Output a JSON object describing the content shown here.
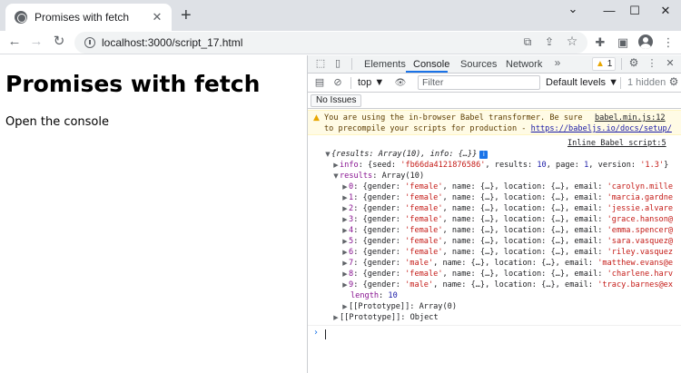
{
  "browser": {
    "tab_title": "Promises with fetch",
    "tab_close": "✕",
    "new_tab": "+",
    "win_minimize": "—",
    "win_maximize": "☐",
    "win_close": "✕",
    "collapse": "⌄",
    "url": "localhost:3000/script_17.html",
    "nav": {
      "back": "←",
      "forward": "→",
      "reload": "↻"
    },
    "omnibox_icons": {
      "translate": "⧉",
      "share": "⇪",
      "bookmark": "☆"
    },
    "toolbar_icons": {
      "extensions": "✚",
      "sidepanel": "▣",
      "menu": "⋮"
    }
  },
  "page": {
    "heading": "Promises with fetch",
    "text": "Open the console"
  },
  "devtools": {
    "icons": {
      "inspect": "⬚",
      "device": "▯",
      "more_tabs": "»",
      "settings": "⚙",
      "kebab": "⋮",
      "close": "✕",
      "sidebar": "▤",
      "clear": "⊘",
      "eye": "👁",
      "filter_settings": "⚙"
    },
    "tabs": [
      "Elements",
      "Console",
      "Sources",
      "Network"
    ],
    "active_tab": "Console",
    "warning_count": "1",
    "context": "top ▼",
    "filter_placeholder": "Filter",
    "levels": "Default levels ▼",
    "hidden": "1 hidden",
    "issues": "No Issues",
    "warning": {
      "line1": "You are using the in-browser Babel transformer. Be sure",
      "line2_prefix": "to precompile your scripts for production - ",
      "line2_link": "https://babeljs.io/docs/setup/",
      "source": "babel.min.js:12"
    },
    "log_source": "Inline Babel script:5",
    "log": {
      "summary": "{results: Array(10), info: {…}}",
      "info_key": "info",
      "info_open": ": {seed: ",
      "info_seed": "'fb66da4121876586'",
      "info_mid1": ", results: ",
      "info_results": "10",
      "info_mid2": ", page: ",
      "info_page": "1",
      "info_mid3": ", version: ",
      "info_version": "'1.3'",
      "info_close": "}",
      "results_key": "results",
      "results_val": ": Array(10)",
      "items": [
        {
          "idx": "0",
          "gender": "'female'",
          "email": "'carolyn.mille"
        },
        {
          "idx": "1",
          "gender": "'female'",
          "email": "'marcia.gardne"
        },
        {
          "idx": "2",
          "gender": "'female'",
          "email": "'jessie.alvare"
        },
        {
          "idx": "3",
          "gender": "'female'",
          "email": "'grace.hanson@"
        },
        {
          "idx": "4",
          "gender": "'female'",
          "email": "'emma.spencer@"
        },
        {
          "idx": "5",
          "gender": "'female'",
          "email": "'sara.vasquez@"
        },
        {
          "idx": "6",
          "gender": "'female'",
          "email": "'riley.vasquez"
        },
        {
          "idx": "7",
          "gender": "'male'",
          "email": "'matthew.evans@e"
        },
        {
          "idx": "8",
          "gender": "'female'",
          "email": "'charlene.harv"
        },
        {
          "idx": "9",
          "gender": "'male'",
          "email": "'tracy.barnes@ex"
        }
      ],
      "item_mid": ", name: {…}, location: {…}, email: ",
      "length_key": "length",
      "length_val": "10",
      "proto_array": "[[Prototype]]: Array(0)",
      "proto_object": "[[Prototype]]: Object"
    },
    "prompt": "›"
  }
}
